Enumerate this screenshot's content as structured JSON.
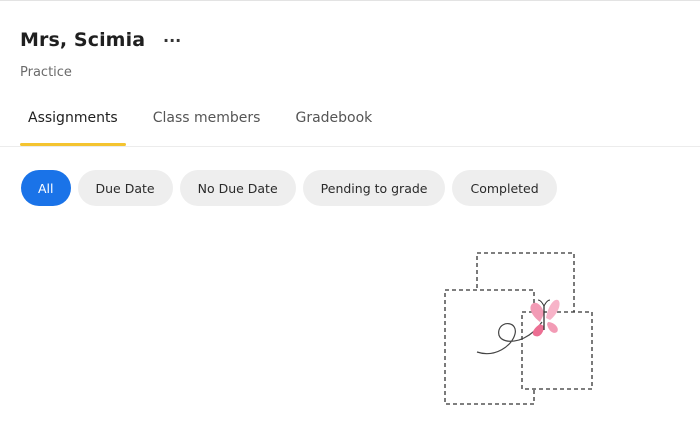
{
  "header": {
    "title": "Mrs, Scimia",
    "more_label": "···",
    "subtitle": "Practice"
  },
  "tabs": [
    {
      "label": "Assignments",
      "active": true
    },
    {
      "label": "Class members",
      "active": false
    },
    {
      "label": "Gradebook",
      "active": false
    }
  ],
  "filters": [
    {
      "label": "All",
      "active": true
    },
    {
      "label": "Due Date",
      "active": false
    },
    {
      "label": "No Due Date",
      "active": false
    },
    {
      "label": "Pending to grade",
      "active": false
    },
    {
      "label": "Completed",
      "active": false
    }
  ],
  "colors": {
    "accent": "#1a73e8",
    "tab_indicator": "#f4c430",
    "chip_bg": "#eeeeee",
    "butterfly": "#f29bb5"
  },
  "empty_state": {
    "illustration": "butterfly-dashed-squares-icon"
  }
}
